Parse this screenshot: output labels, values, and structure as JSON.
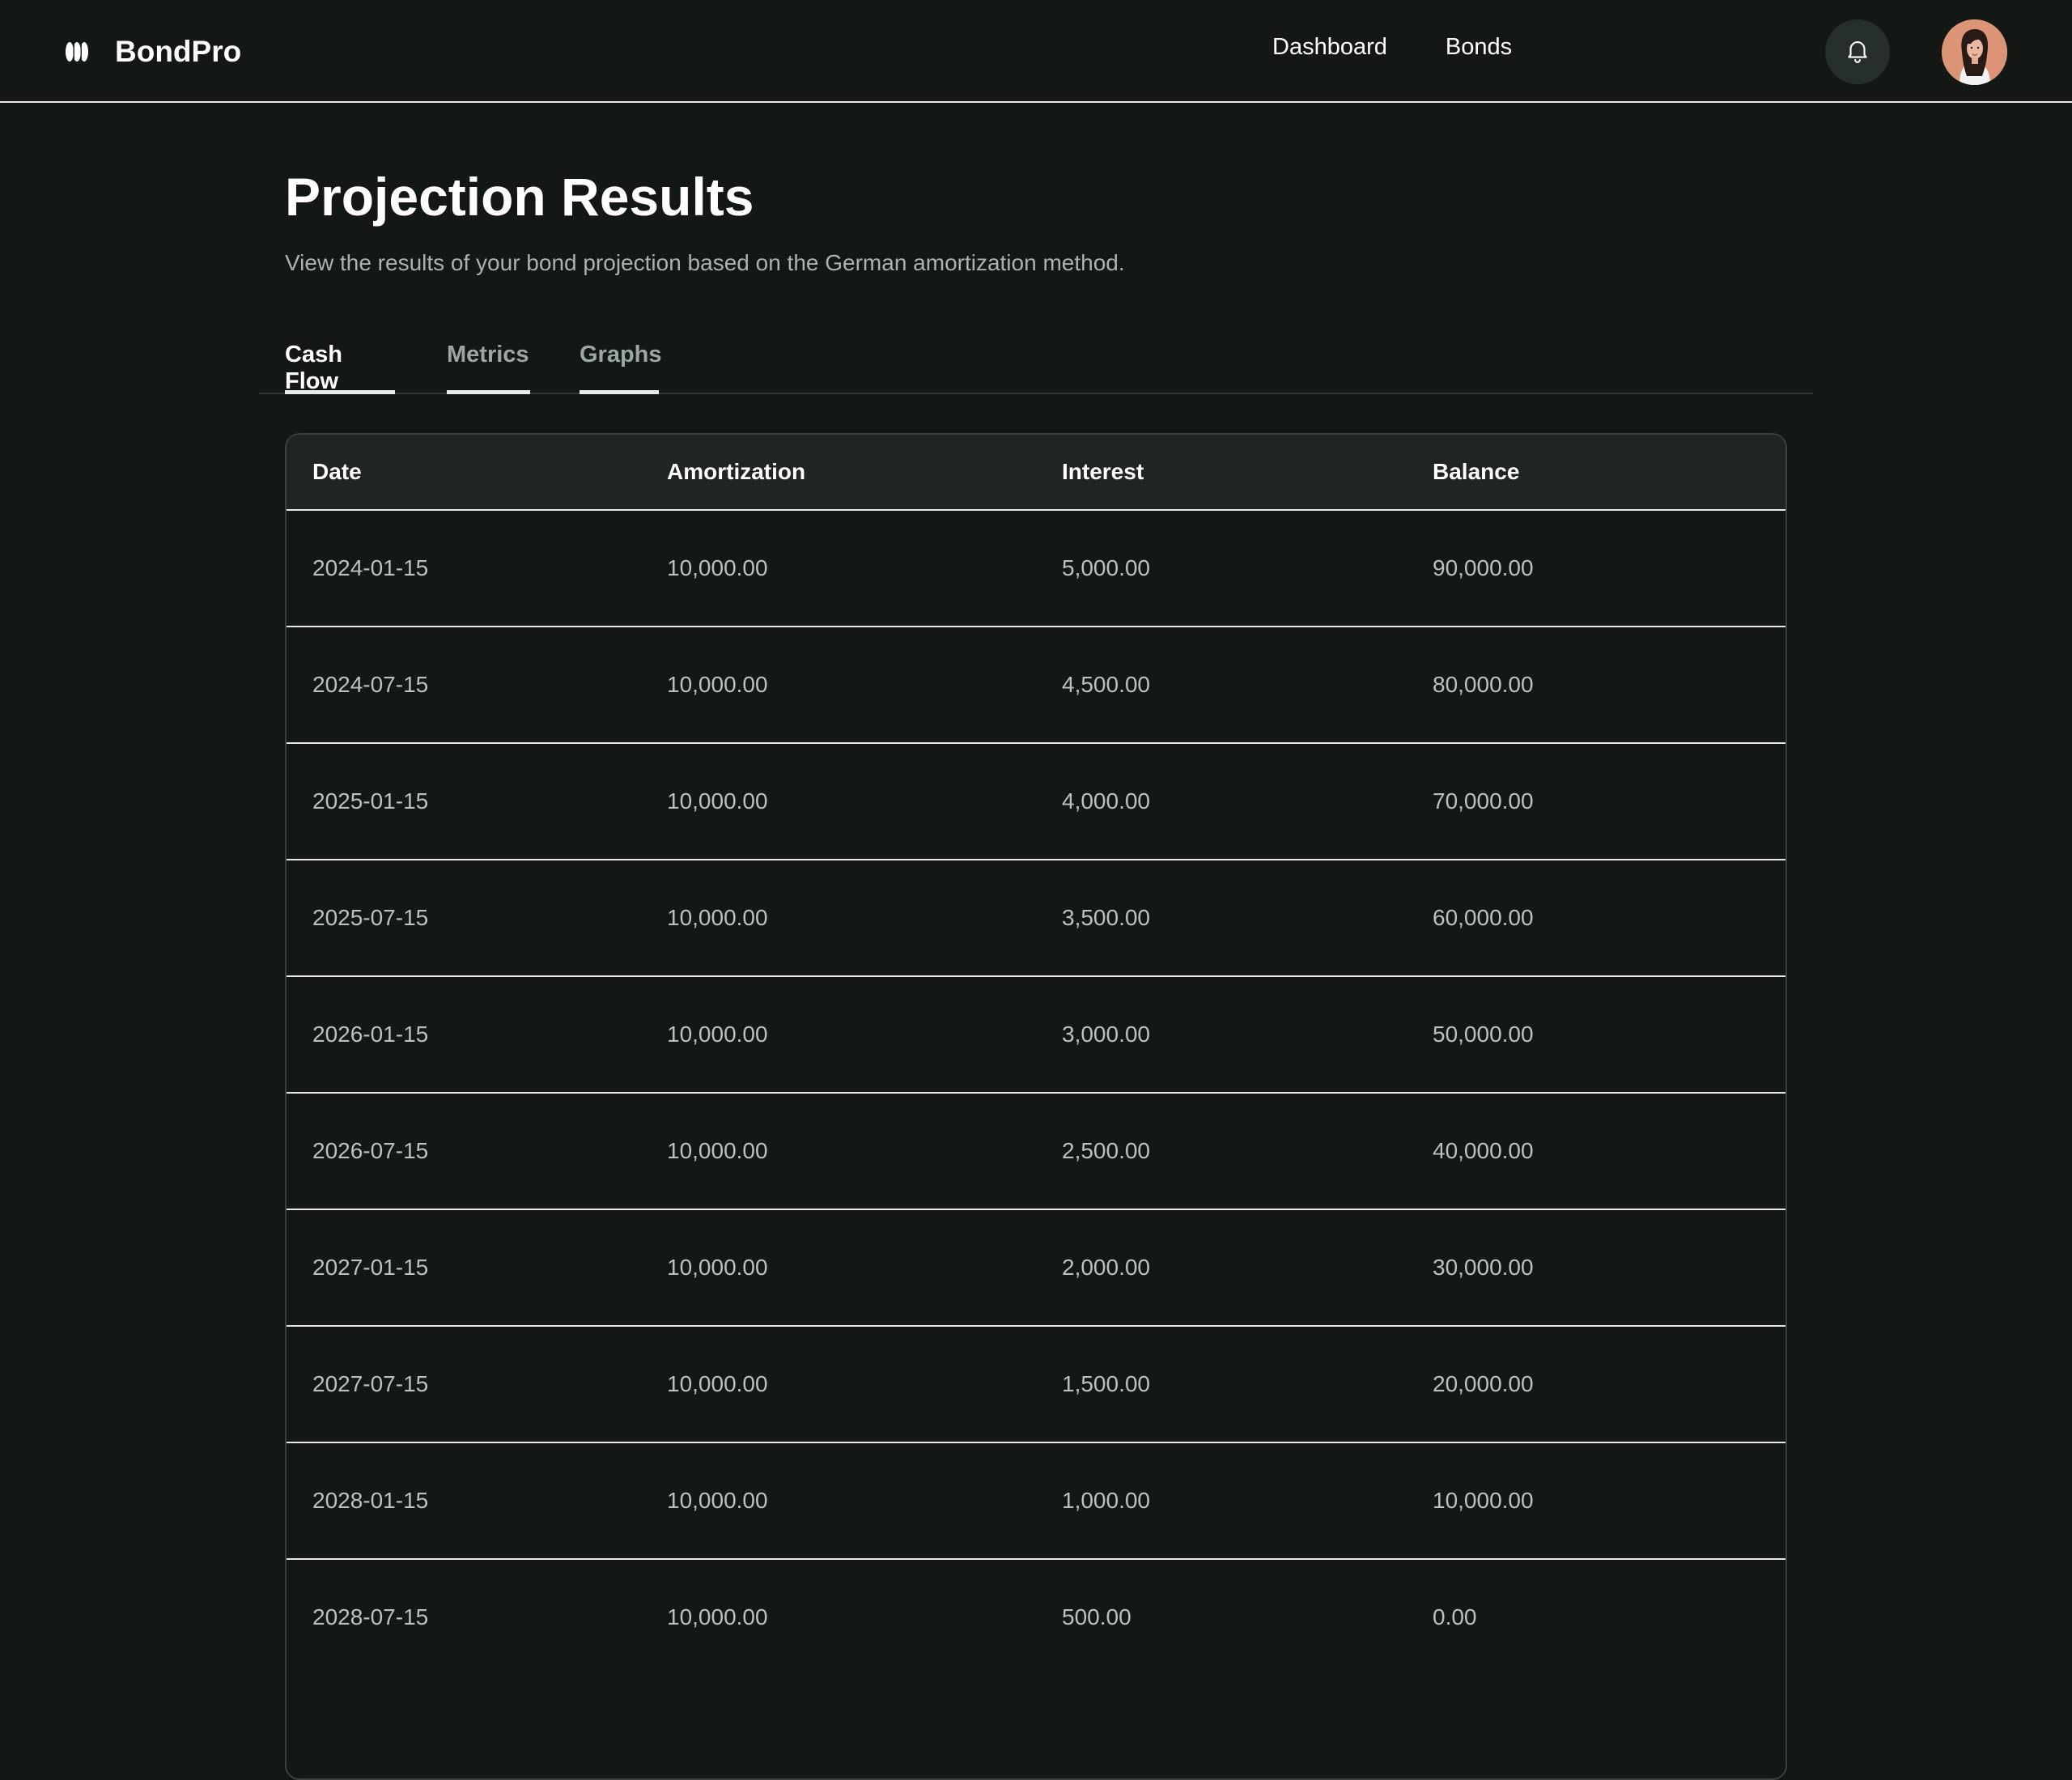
{
  "app": {
    "brand_name": "BondPro"
  },
  "nav": {
    "links": [
      "Dashboard",
      "Bonds"
    ]
  },
  "header": {
    "title": "Projection Results",
    "subtitle": "View the results of your bond projection based on the German amortization method."
  },
  "tabs": [
    {
      "label": "Cash Flow",
      "active": true
    },
    {
      "label": "Metrics",
      "active": false
    },
    {
      "label": "Graphs",
      "active": false
    }
  ],
  "table": {
    "columns": [
      "Date",
      "Amortization",
      "Interest",
      "Balance"
    ],
    "rows": [
      [
        "2024-01-15",
        "10,000.00",
        "5,000.00",
        "90,000.00"
      ],
      [
        "2024-07-15",
        "10,000.00",
        "4,500.00",
        "80,000.00"
      ],
      [
        "2025-01-15",
        "10,000.00",
        "4,000.00",
        "70,000.00"
      ],
      [
        "2025-07-15",
        "10,000.00",
        "3,500.00",
        "60,000.00"
      ],
      [
        "2026-01-15",
        "10,000.00",
        "3,000.00",
        "50,000.00"
      ],
      [
        "2026-07-15",
        "10,000.00",
        "2,500.00",
        "40,000.00"
      ],
      [
        "2027-01-15",
        "10,000.00",
        "2,000.00",
        "30,000.00"
      ],
      [
        "2027-07-15",
        "10,000.00",
        "1,500.00",
        "20,000.00"
      ],
      [
        "2028-01-15",
        "10,000.00",
        "1,000.00",
        "10,000.00"
      ],
      [
        "2028-07-15",
        "10,000.00",
        "500.00",
        "0.00"
      ]
    ]
  },
  "icons": {
    "logo": "logo-icon",
    "notifications": "bell-icon",
    "avatar": "user-avatar"
  },
  "colors": {
    "background": "#131814",
    "header_row": "#1f2521",
    "muted_text": "#a9b4ad",
    "divider": "#e6e9e7"
  }
}
